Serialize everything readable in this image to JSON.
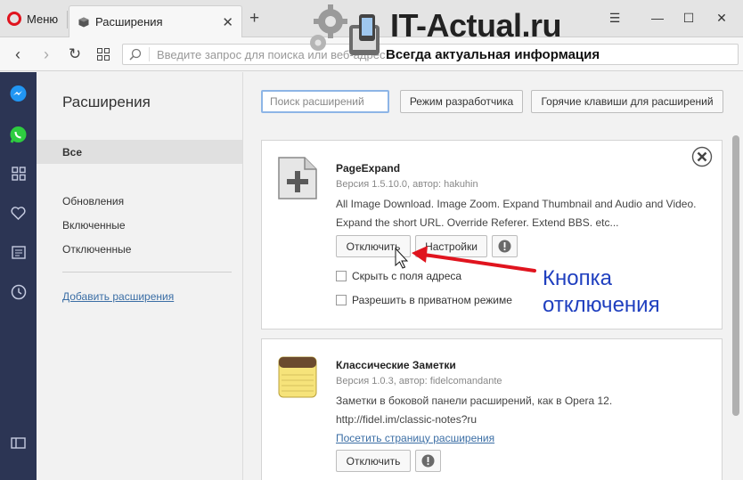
{
  "browser": {
    "menu_label": "Меню",
    "tab_title": "Расширения",
    "address_placeholder": "Введите запрос для поиска или веб-адрес"
  },
  "watermark": {
    "title": "IT-Actual.ru",
    "subtitle": "Всегда актуальная информация"
  },
  "nav": {
    "title": "Расширения",
    "all": "Все",
    "updates": "Обновления",
    "enabled": "Включенные",
    "disabled": "Отключенные",
    "add": "Добавить расширения"
  },
  "toolbar": {
    "search_placeholder": "Поиск расширений",
    "dev_mode": "Режим разработчика",
    "hotkeys": "Горячие клавиши для расширений"
  },
  "extensions": [
    {
      "name": "PageExpand",
      "meta": "Версия 1.5.10.0, автор: hakuhin",
      "desc_line1": "All Image Download. Image Zoom. Expand Thumbnail and Audio and Video.",
      "desc_line2": "Expand the short URL. Override Referer. Extend BBS. etc...",
      "disable_label": "Отключить",
      "settings_label": "Настройки",
      "hide_from_address": "Скрыть с поля адреса",
      "allow_private": "Разрешить в приватном режиме"
    },
    {
      "name": "Классические Заметки",
      "meta": "Версия 1.0.3, автор: fidelcomandante",
      "desc_line1": "Заметки в боковой панели расширений, как в Opera 12.",
      "desc_line2": "http://fidel.im/classic-notes?ru",
      "visit_page": "Посетить страницу расширения",
      "disable_label": "Отключить"
    }
  ],
  "annotation": {
    "line1": "Кнопка",
    "line2": "отключения",
    "color": "#1f3fbf",
    "arrow_color": "#e0141e"
  },
  "icons": [
    "opera-logo-icon",
    "cube-icon",
    "close-icon",
    "plus-icon",
    "minimize-icon",
    "maximize-icon",
    "back-icon",
    "forward-icon",
    "reload-icon",
    "speed-dial-icon",
    "search-icon",
    "messenger-icon",
    "whatsapp-icon",
    "grid-icon",
    "heart-icon",
    "news-icon",
    "clock-icon",
    "sidebar-toggle-icon",
    "warning-icon",
    "notepad-icon",
    "puzzle-icon"
  ]
}
